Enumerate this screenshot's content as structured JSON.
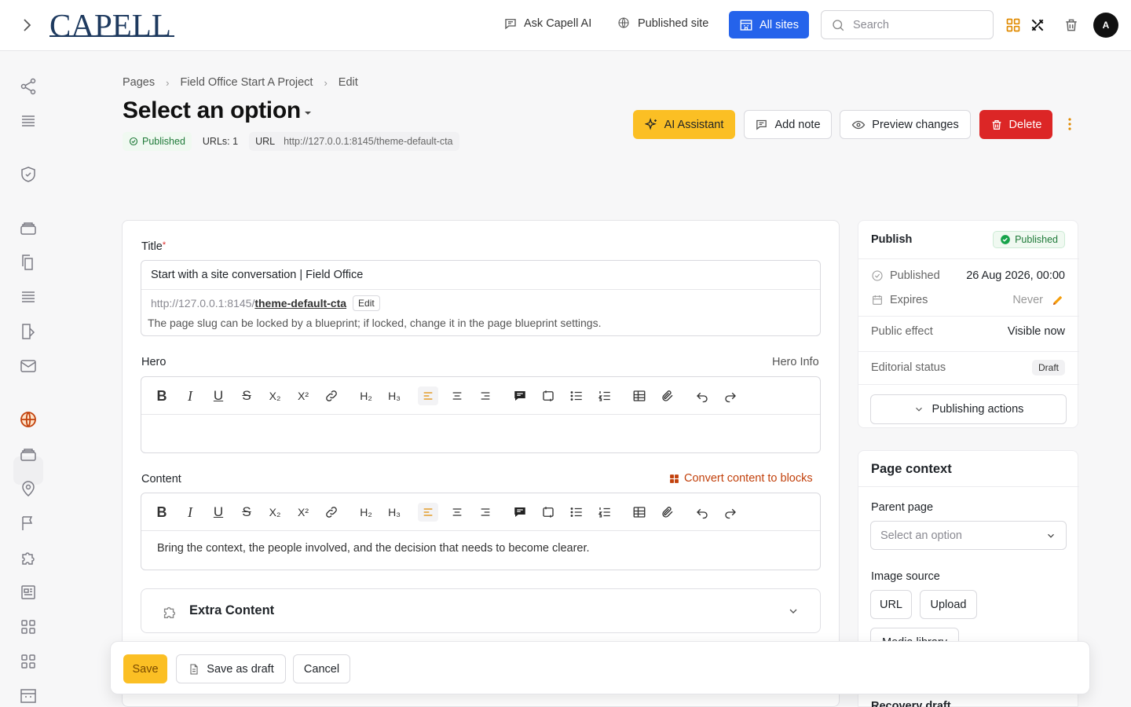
{
  "topbar": {
    "logo": "CAPELL",
    "ask_ai": "Ask Capell AI",
    "published_site": "Published site",
    "all_sites": "All sites",
    "search_placeholder": "Search",
    "avatar_initial": "A"
  },
  "breadcrumb": [
    "Pages",
    "Field Office Start A Project",
    "Edit"
  ],
  "page": {
    "title": "Select an option",
    "status": "Published",
    "urls": "URLs: 1",
    "url_label": "URL",
    "url_value": "http://127.0.0.1:8145/theme-default-cta"
  },
  "header_actions": {
    "ai_assistant": "AI Assistant",
    "add_note": "Add note",
    "preview": "Preview changes",
    "delete": "Delete"
  },
  "form": {
    "title_label": "Title",
    "title_required": "*",
    "title_value": "Start with a site conversation | Field Office",
    "slug_base": "http://127.0.0.1:8145/",
    "slug_value": "theme-default-cta",
    "slug_edit": "Edit",
    "slug_help": "The page slug can be locked by a blueprint; if locked, change it in the page blueprint settings.",
    "hero_label": "Hero",
    "hero_info": "Hero Info",
    "content_label": "Content",
    "convert_blocks": "Convert content to blocks",
    "content_text": "Bring the context, the people involved, and the decision that needs to become clearer.",
    "extra_content": "Extra Content"
  },
  "toolbar_tools": [
    {
      "name": "bold",
      "glyph": "B"
    },
    {
      "name": "italic",
      "glyph": "I"
    },
    {
      "name": "underline",
      "glyph": "U"
    },
    {
      "name": "strike",
      "glyph": "S"
    },
    {
      "name": "subscript",
      "glyph": "X₂"
    },
    {
      "name": "superscript",
      "glyph": "X²"
    },
    {
      "name": "link",
      "glyph": ""
    },
    {
      "name": "h2",
      "glyph": "H₂"
    },
    {
      "name": "h3",
      "glyph": "H₃"
    }
  ],
  "publish": {
    "heading": "Publish",
    "badge": "Published",
    "published_label": "Published",
    "published_value": "26 Aug 2026, 00:00",
    "expires_label": "Expires",
    "expires_value": "Never",
    "public_effect_label": "Public effect",
    "public_effect_value": "Visible now",
    "editorial_label": "Editorial status",
    "editorial_value": "Draft",
    "actions": "Publishing actions"
  },
  "context": {
    "heading": "Page context",
    "parent_label": "Parent page",
    "parent_placeholder": "Select an option",
    "image_source_label": "Image source",
    "url_chip": "URL",
    "upload_chip": "Upload",
    "media_chip": "Media library",
    "recovery": "Recovery draft"
  },
  "bottombar": {
    "save": "Save",
    "save_draft": "Save as draft",
    "cancel": "Cancel"
  },
  "colors": {
    "accent": "#fbbf24",
    "primary": "#2563eb",
    "danger": "#dc2626",
    "success": "#1f7a39"
  }
}
